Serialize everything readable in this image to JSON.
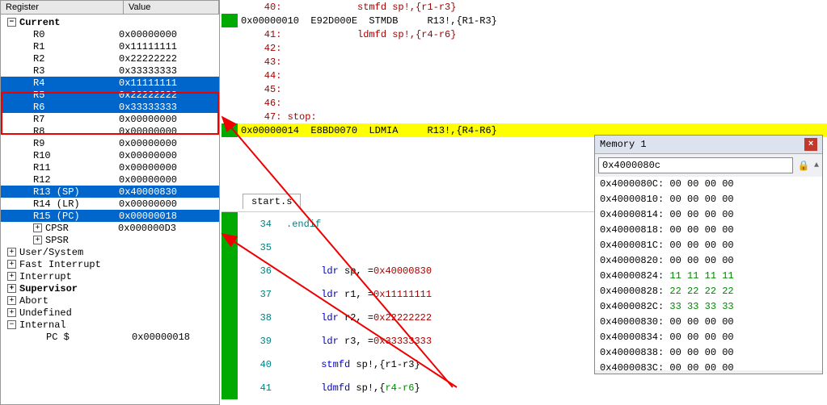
{
  "regpanel": {
    "header": {
      "col1": "Register",
      "col2": "Value"
    },
    "root": "Current",
    "regs": [
      {
        "n": "R0",
        "v": "0x00000000",
        "sel": false
      },
      {
        "n": "R1",
        "v": "0x11111111",
        "sel": false
      },
      {
        "n": "R2",
        "v": "0x22222222",
        "sel": false
      },
      {
        "n": "R3",
        "v": "0x33333333",
        "sel": false
      },
      {
        "n": "R4",
        "v": "0x11111111",
        "sel": true
      },
      {
        "n": "R5",
        "v": "0x22222222",
        "sel": true
      },
      {
        "n": "R6",
        "v": "0x33333333",
        "sel": true
      },
      {
        "n": "R7",
        "v": "0x00000000",
        "sel": false
      },
      {
        "n": "R8",
        "v": "0x00000000",
        "sel": false
      },
      {
        "n": "R9",
        "v": "0x00000000",
        "sel": false
      },
      {
        "n": "R10",
        "v": "0x00000000",
        "sel": false
      },
      {
        "n": "R11",
        "v": "0x00000000",
        "sel": false
      },
      {
        "n": "R12",
        "v": "0x00000000",
        "sel": false
      },
      {
        "n": "R13 (SP)",
        "v": "0x40000830",
        "sel": true
      },
      {
        "n": "R14 (LR)",
        "v": "0x00000000",
        "sel": false
      },
      {
        "n": "R15 (PC)",
        "v": "0x00000018",
        "sel": true
      }
    ],
    "sub": [
      {
        "n": "CPSR",
        "v": "0x000000D3",
        "exp": "+"
      },
      {
        "n": "SPSR",
        "v": "",
        "exp": "+"
      }
    ],
    "modes": [
      {
        "n": "User/System",
        "exp": "+",
        "bold": false
      },
      {
        "n": "Fast Interrupt",
        "exp": "+",
        "bold": false
      },
      {
        "n": "Interrupt",
        "exp": "+",
        "bold": false
      },
      {
        "n": "Supervisor",
        "exp": "+",
        "bold": true
      },
      {
        "n": "Abort",
        "exp": "+",
        "bold": false
      },
      {
        "n": "Undefined",
        "exp": "+",
        "bold": false
      },
      {
        "n": "Internal",
        "exp": "−",
        "bold": false
      }
    ],
    "internal_pc": {
      "n": "PC $",
      "v": "0x00000018"
    }
  },
  "disasm": {
    "lines": [
      {
        "g": "",
        "txt": "    40:             stmfd sp!,{r1-r3}",
        "cls": "c-red"
      },
      {
        "g": "grn",
        "txt": "0x00000010  E92D000E  STMDB     R13!,{R1-R3}",
        "cls": ""
      },
      {
        "g": "",
        "txt": "    41:             ldmfd sp!,{r4-r6}",
        "cls": "c-red"
      },
      {
        "g": "",
        "txt": "    42:",
        "cls": "c-red"
      },
      {
        "g": "",
        "txt": "    43:",
        "cls": "c-red"
      },
      {
        "g": "",
        "txt": "    44:",
        "cls": "c-red"
      },
      {
        "g": "",
        "txt": "    45:",
        "cls": "c-red"
      },
      {
        "g": "",
        "txt": "    46:",
        "cls": "c-red"
      },
      {
        "g": "",
        "txt": "    47: stop:",
        "cls": "c-red"
      },
      {
        "g": "grn",
        "txt": "0x00000014  E8BD0070  LDMIA     R13!,{R4-R6}",
        "cls": "",
        "hl": true
      }
    ]
  },
  "src": {
    "tab": "start.s",
    "lines": [
      {
        "ln": "34",
        "code": ".endif",
        "parts": [
          {
            "t": ".endif",
            "c": "c-teal"
          }
        ]
      },
      {
        "ln": "35",
        "code": "",
        "parts": []
      },
      {
        "ln": "36",
        "code": "      ldr sp, =0x40000830",
        "parts": [
          {
            "t": "      ",
            "c": ""
          },
          {
            "t": "ldr",
            "c": "c-blue"
          },
          {
            "t": " sp, =",
            "c": ""
          },
          {
            "t": "0x40000830",
            "c": "c-red"
          }
        ]
      },
      {
        "ln": "37",
        "code": "      ldr r1, =0x11111111",
        "parts": [
          {
            "t": "      ",
            "c": ""
          },
          {
            "t": "ldr",
            "c": "c-blue"
          },
          {
            "t": " r1, =",
            "c": ""
          },
          {
            "t": "0x11111111",
            "c": "c-red"
          }
        ]
      },
      {
        "ln": "38",
        "code": "      ldr r2, =0x22222222",
        "parts": [
          {
            "t": "      ",
            "c": ""
          },
          {
            "t": "ldr",
            "c": "c-blue"
          },
          {
            "t": " r2, =",
            "c": ""
          },
          {
            "t": "0x22222222",
            "c": "c-red"
          }
        ]
      },
      {
        "ln": "39",
        "code": "      ldr r3, =0x33333333",
        "parts": [
          {
            "t": "      ",
            "c": ""
          },
          {
            "t": "ldr",
            "c": "c-blue"
          },
          {
            "t": " r3, =",
            "c": ""
          },
          {
            "t": "0x33333333",
            "c": "c-red"
          }
        ]
      },
      {
        "ln": "40",
        "code": "      stmfd sp!,{r1-r3}",
        "parts": [
          {
            "t": "      ",
            "c": ""
          },
          {
            "t": "stmfd",
            "c": "c-blue"
          },
          {
            "t": " sp!,{r1-r3}",
            "c": ""
          }
        ]
      },
      {
        "ln": "41",
        "code": "      ldmfd sp!,{r4-r6}",
        "parts": [
          {
            "t": "      ",
            "c": ""
          },
          {
            "t": "ldmfd",
            "c": "c-blue"
          },
          {
            "t": " sp!,{",
            "c": ""
          },
          {
            "t": "r4-r6",
            "c": "c-green"
          },
          {
            "t": "}",
            "c": ""
          }
        ]
      }
    ]
  },
  "memory": {
    "title": "Memory 1",
    "addr": "0x4000080c",
    "rows": [
      {
        "a": "0x4000080C:",
        "b": "00 00 00 00",
        "c": ""
      },
      {
        "a": "0x40000810:",
        "b": "00 00 00 00",
        "c": ""
      },
      {
        "a": "0x40000814:",
        "b": "00 00 00 00",
        "c": ""
      },
      {
        "a": "0x40000818:",
        "b": "00 00 00 00",
        "c": ""
      },
      {
        "a": "0x4000081C:",
        "b": "00 00 00 00",
        "c": ""
      },
      {
        "a": "0x40000820:",
        "b": "00 00 00 00",
        "c": ""
      },
      {
        "a": "0x40000824:",
        "b": "11 11 11 11",
        "c": "c-green"
      },
      {
        "a": "0x40000828:",
        "b": "22 22 22 22",
        "c": "c-green"
      },
      {
        "a": "0x4000082C:",
        "b": "33 33 33 33",
        "c": "c-green"
      },
      {
        "a": "0x40000830:",
        "b": "00 00 00 00",
        "c": ""
      },
      {
        "a": "0x40000834:",
        "b": "00 00 00 00",
        "c": ""
      },
      {
        "a": "0x40000838:",
        "b": "00 00 00 00",
        "c": ""
      },
      {
        "a": "0x4000083C:",
        "b": "00 00 00 00",
        "c": ""
      }
    ]
  }
}
